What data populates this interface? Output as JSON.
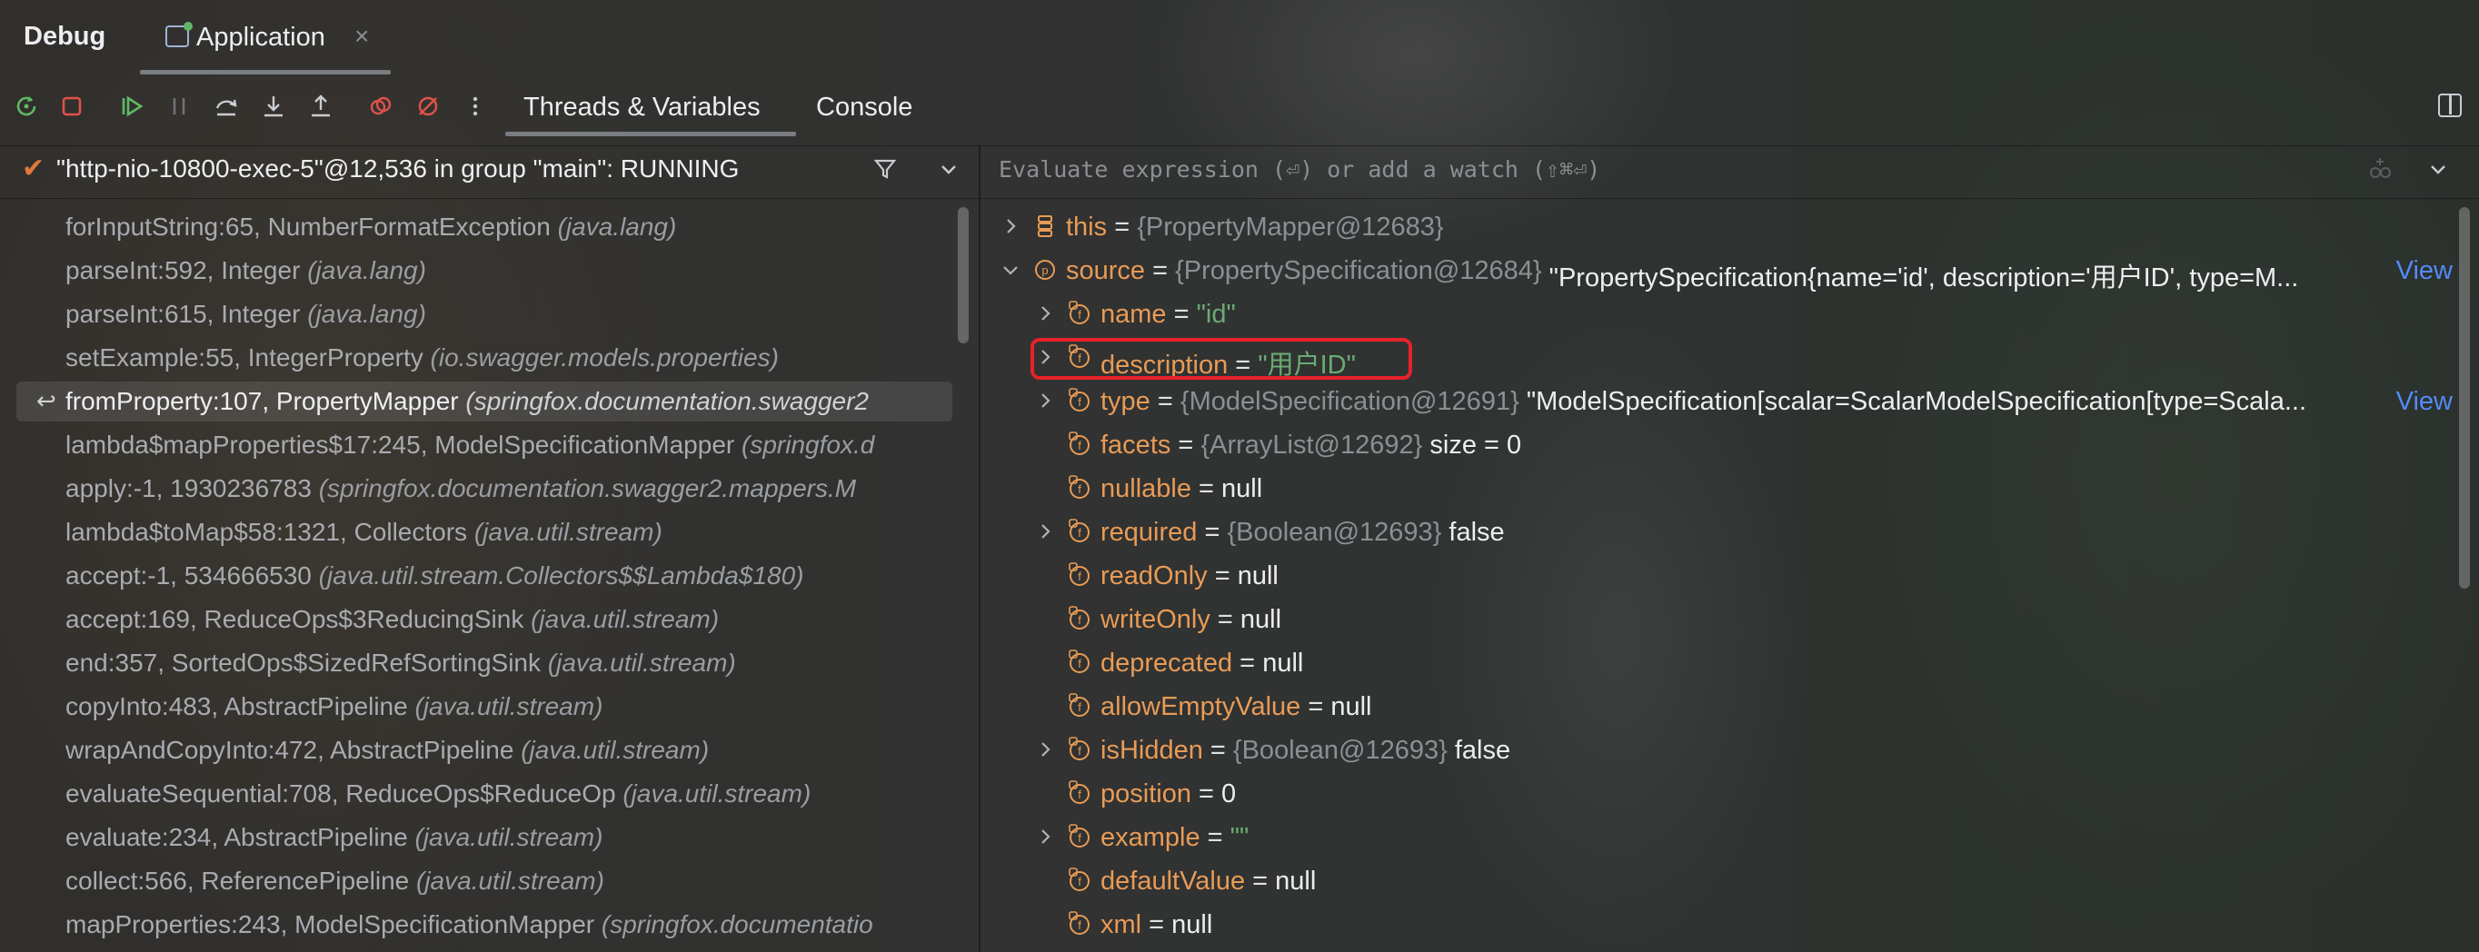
{
  "header": {
    "title": "Debug",
    "tab_label": "Application",
    "tab_close": "×"
  },
  "toolbar": {
    "icons": [
      "rerun-icon",
      "stop-icon",
      "resume-icon",
      "pause-icon",
      "step-over-icon",
      "step-into-icon",
      "step-out-icon",
      "view-breakpoints-icon",
      "mute-breakpoints-icon",
      "more-icon"
    ],
    "tabs": [
      "Threads & Variables",
      "Console"
    ]
  },
  "thread": {
    "status_icon": "✔",
    "label": "\"http-nio-10800-exec-5\"@12,536 in group \"main\": RUNNING"
  },
  "frames": [
    {
      "name": "forInputString:65, NumberFormatException",
      "pkg": "(java.lang)"
    },
    {
      "name": "parseInt:592, Integer",
      "pkg": "(java.lang)"
    },
    {
      "name": "parseInt:615, Integer",
      "pkg": "(java.lang)"
    },
    {
      "name": "setExample:55, IntegerProperty",
      "pkg": "(io.swagger.models.properties)"
    },
    {
      "name": "fromProperty:107, PropertyMapper",
      "pkg": "(springfox.documentation.swagger2"
    },
    {
      "name": "lambda$mapProperties$17:245, ModelSpecificationMapper",
      "pkg": "(springfox.d"
    },
    {
      "name": "apply:-1, 1930236783",
      "pkg": "(springfox.documentation.swagger2.mappers.M"
    },
    {
      "name": "lambda$toMap$58:1321, Collectors",
      "pkg": "(java.util.stream)"
    },
    {
      "name": "accept:-1, 534666530",
      "pkg": "(java.util.stream.Collectors$$Lambda$180)"
    },
    {
      "name": "accept:169, ReduceOps$3ReducingSink",
      "pkg": "(java.util.stream)"
    },
    {
      "name": "end:357, SortedOps$SizedRefSortingSink",
      "pkg": "(java.util.stream)"
    },
    {
      "name": "copyInto:483, AbstractPipeline",
      "pkg": "(java.util.stream)"
    },
    {
      "name": "wrapAndCopyInto:472, AbstractPipeline",
      "pkg": "(java.util.stream)"
    },
    {
      "name": "evaluateSequential:708, ReduceOps$ReduceOp",
      "pkg": "(java.util.stream)"
    },
    {
      "name": "evaluate:234, AbstractPipeline",
      "pkg": "(java.util.stream)"
    },
    {
      "name": "collect:566, ReferencePipeline",
      "pkg": "(java.util.stream)"
    },
    {
      "name": "mapProperties:243, ModelSpecificationMapper",
      "pkg": "(springfox.documentatio"
    }
  ],
  "current_frame_index": 4,
  "evaluate": {
    "placeholder": "Evaluate expression (⏎) or add a watch (⇧⌘⏎)"
  },
  "variables": [
    {
      "name": "this",
      "type": "{PropertyMapper@12683}",
      "value": "",
      "kind": "object",
      "indent": 0,
      "expandable": true,
      "expanded": false
    },
    {
      "name": "source",
      "type": "{PropertySpecification@12684}",
      "value": "\"PropertySpecification{name='id', description='用户ID', type=M...",
      "kind": "param",
      "indent": 0,
      "expandable": true,
      "expanded": true,
      "view": "View"
    },
    {
      "name": "name",
      "type": "",
      "value": "\"id\"",
      "kind": "field",
      "indent": 1,
      "expandable": true,
      "string": true
    },
    {
      "name": "description",
      "type": "",
      "value": "\"用户ID\"",
      "kind": "field",
      "indent": 1,
      "expandable": true,
      "string": true,
      "highlighted": true
    },
    {
      "name": "type",
      "type": "{ModelSpecification@12691}",
      "value": "\"ModelSpecification[scalar=ScalarModelSpecification[type=Scala...",
      "kind": "field",
      "indent": 1,
      "expandable": true,
      "view": "View"
    },
    {
      "name": "facets",
      "type": "{ArrayList@12692}",
      "value": " size = 0",
      "kind": "field",
      "indent": 1,
      "expandable": false
    },
    {
      "name": "nullable",
      "type": "",
      "value": "null",
      "kind": "field",
      "indent": 1,
      "expandable": false
    },
    {
      "name": "required",
      "type": "{Boolean@12693}",
      "value": "false",
      "kind": "field",
      "indent": 1,
      "expandable": true
    },
    {
      "name": "readOnly",
      "type": "",
      "value": "null",
      "kind": "field",
      "indent": 1,
      "expandable": false
    },
    {
      "name": "writeOnly",
      "type": "",
      "value": "null",
      "kind": "field",
      "indent": 1,
      "expandable": false
    },
    {
      "name": "deprecated",
      "type": "",
      "value": "null",
      "kind": "field",
      "indent": 1,
      "expandable": false
    },
    {
      "name": "allowEmptyValue",
      "type": "",
      "value": "null",
      "kind": "field",
      "indent": 1,
      "expandable": false
    },
    {
      "name": "isHidden",
      "type": "{Boolean@12693}",
      "value": "false",
      "kind": "field",
      "indent": 1,
      "expandable": true
    },
    {
      "name": "position",
      "type": "",
      "value": "0",
      "kind": "field",
      "indent": 1,
      "expandable": false
    },
    {
      "name": "example",
      "type": "",
      "value": "\"\"",
      "kind": "field",
      "indent": 1,
      "expandable": true,
      "string": true
    },
    {
      "name": "defaultValue",
      "type": "",
      "value": "null",
      "kind": "field",
      "indent": 1,
      "expandable": false
    },
    {
      "name": "xml",
      "type": "",
      "value": "null",
      "kind": "field",
      "indent": 1,
      "expandable": false
    }
  ],
  "colors": {
    "var_name": "#e89b56",
    "string_value": "#6aab73",
    "type_ref": "#8c8f94",
    "link": "#548af7",
    "highlight_box": "#e8222a",
    "thread_check": "#e0783a"
  }
}
